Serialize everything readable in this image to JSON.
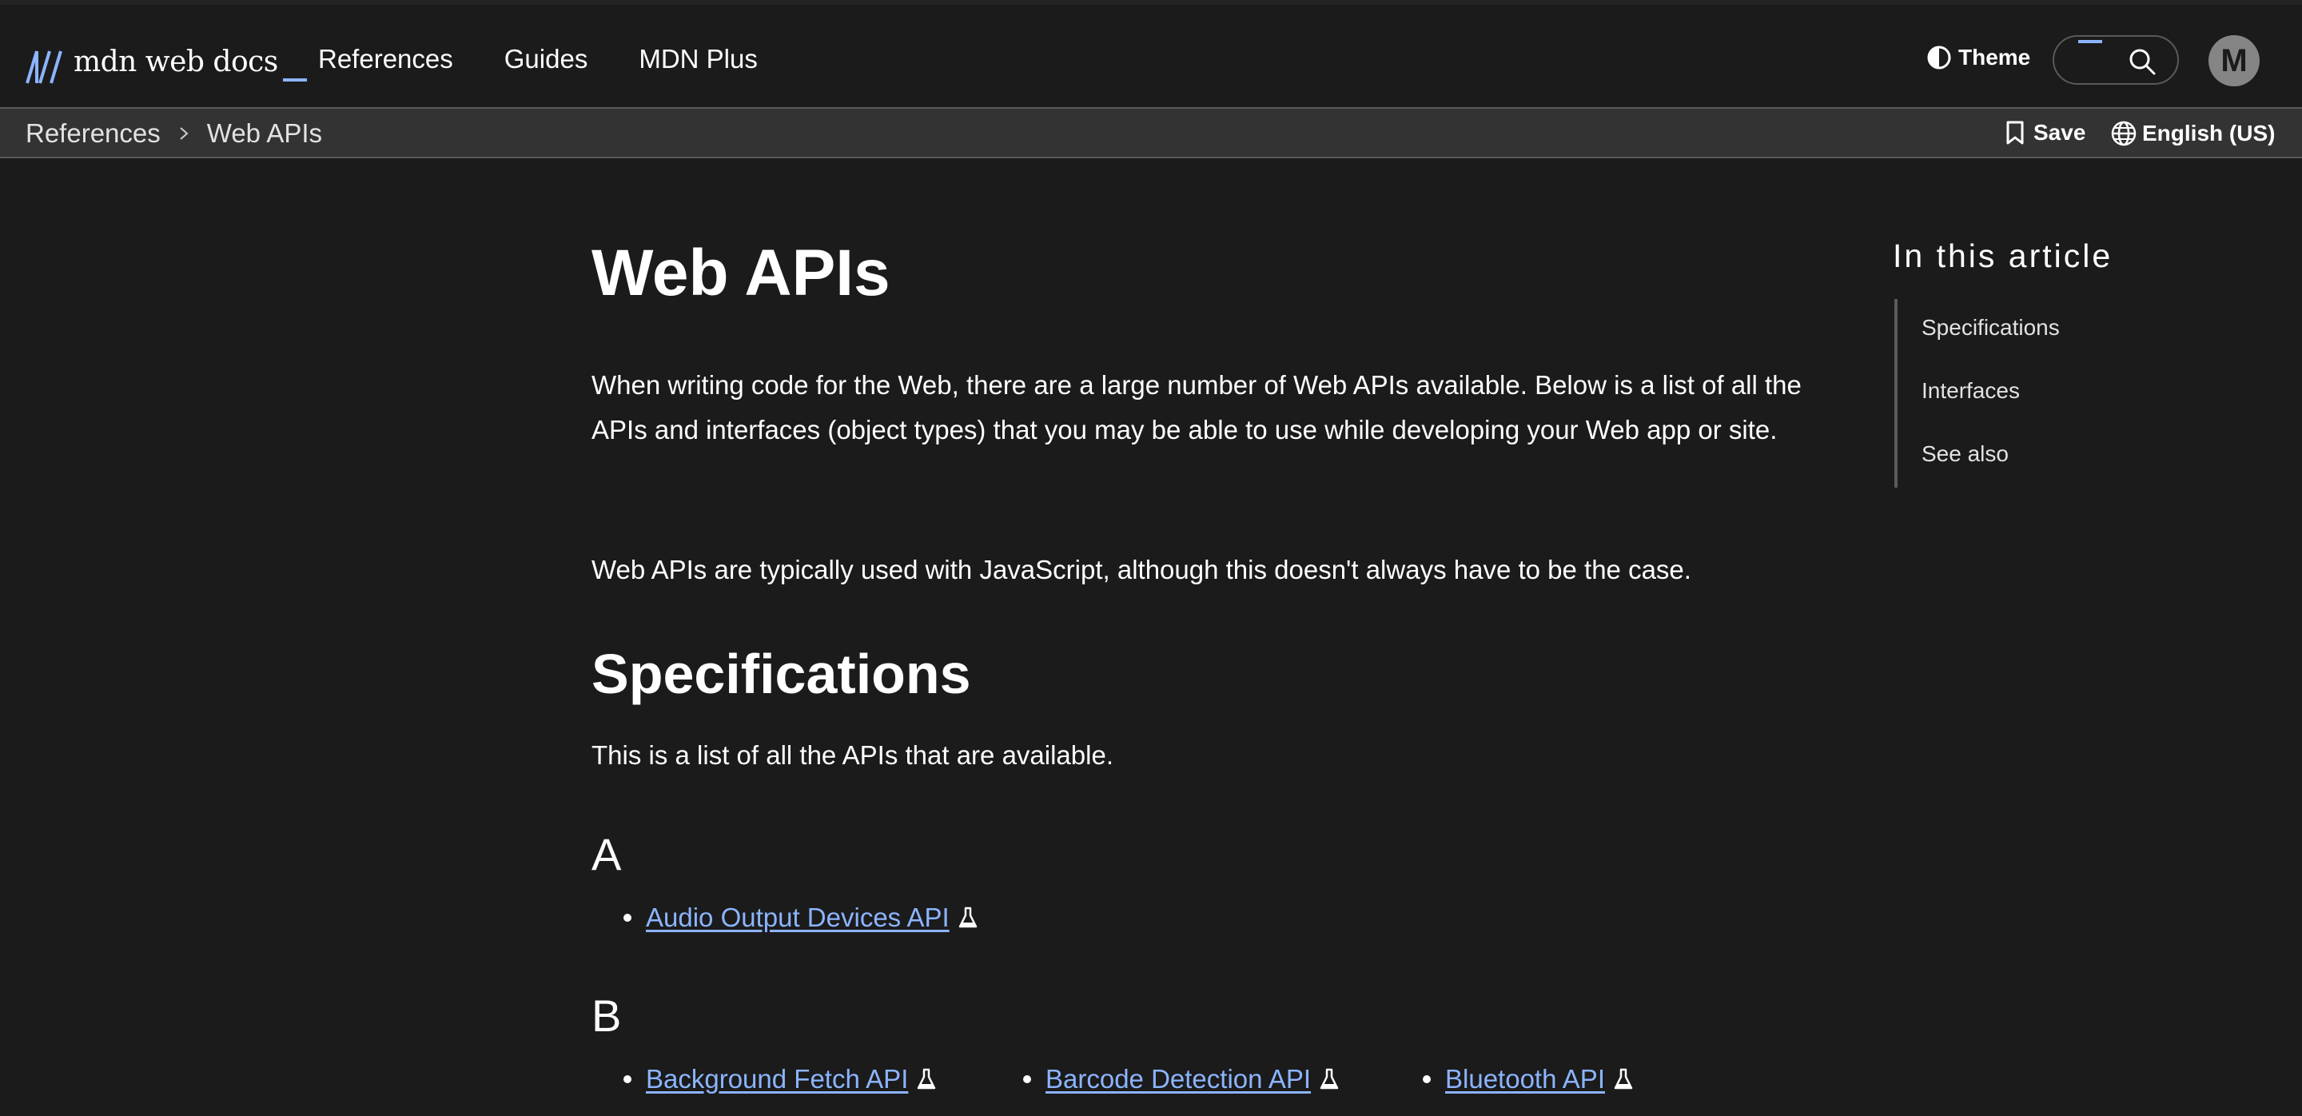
{
  "header": {
    "logo_text": "mdn web docs",
    "nav": [
      "References",
      "Guides",
      "MDN Plus"
    ],
    "theme_label": "Theme",
    "avatar_initial": "M"
  },
  "breadcrumb": {
    "items": [
      "References",
      "Web APIs"
    ],
    "save_label": "Save",
    "language": "English (US)"
  },
  "article": {
    "title": "Web APIs",
    "intro": "When writing code for the Web, there are a large number of Web APIs available. Below is a list of all the APIs and interfaces (object types) that you may be able to use while developing your Web app or site.",
    "note": "Web APIs are typically used with JavaScript, although this doesn't always have to be the case.",
    "spec_heading": "Specifications",
    "spec_intro": "This is a list of all the APIs that are available.",
    "groups": [
      {
        "letter": "A",
        "items": [
          "Audio Output Devices API"
        ]
      },
      {
        "letter": "B",
        "items": [
          "Background Fetch API",
          "Barcode Detection API",
          "Bluetooth API"
        ]
      }
    ]
  },
  "toc": {
    "title": "In this article",
    "links": [
      "Specifications",
      "Interfaces",
      "See also"
    ]
  },
  "colors": {
    "background": "#1b1b1b",
    "link": "#8cb4ff",
    "breadcrumb_bar": "#333333",
    "text": "#ffffff"
  },
  "icons": {
    "experimental": "flask-icon",
    "theme": "contrast-icon",
    "search": "search-icon",
    "save": "bookmark-icon",
    "language": "globe-icon"
  }
}
